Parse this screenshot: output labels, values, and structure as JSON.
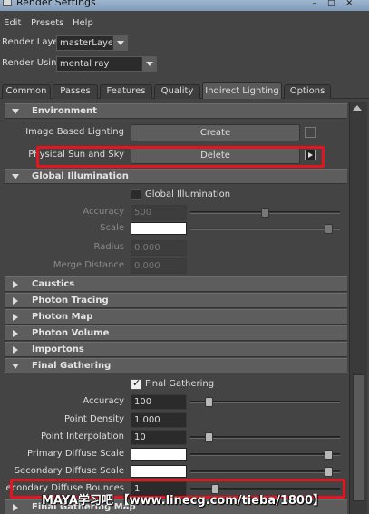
{
  "window": {
    "title": "Render Settings"
  },
  "menu": [
    "Edit",
    "Presets",
    "Help"
  ],
  "render_layer": {
    "label": "Render Layer",
    "value": "masterLayer"
  },
  "render_using": {
    "label": "Render Using",
    "value": "mental ray"
  },
  "tabs": [
    {
      "label": "Common",
      "active": false
    },
    {
      "label": "Passes",
      "active": false
    },
    {
      "label": "Features",
      "active": false
    },
    {
      "label": "Quality",
      "active": false
    },
    {
      "label": "Indirect Lighting",
      "active": true
    },
    {
      "label": "Options",
      "active": false
    }
  ],
  "environment": {
    "title": "Environment",
    "ibl_label": "Image Based Lighting",
    "ibl_button": "Create",
    "sun_label": "Physical Sun and Sky",
    "sun_button": "Delete"
  },
  "global_illumination": {
    "title": "Global Illumination",
    "checkbox_label": "Global Illumination",
    "enabled": false,
    "accuracy": {
      "label": "Accuracy",
      "value": "500",
      "slider": 0.5
    },
    "scale": {
      "label": "Scale",
      "color": "#ffffff",
      "slider": 0.95
    },
    "radius": {
      "label": "Radius",
      "value": "0.000"
    },
    "merge_distance": {
      "label": "Merge Distance",
      "value": "0.000"
    }
  },
  "collapsed_sections": [
    "Caustics",
    "Photon Tracing",
    "Photon Map",
    "Photon Volume",
    "Importons"
  ],
  "final_gathering": {
    "title": "Final Gathering",
    "checkbox_label": "Final Gathering",
    "enabled": true,
    "accuracy": {
      "label": "Accuracy",
      "value": "100",
      "slider": 0.1
    },
    "point_density": {
      "label": "Point Density",
      "value": "1.000"
    },
    "point_interpolation": {
      "label": "Point Interpolation",
      "value": "10",
      "slider": 0.1
    },
    "primary_diffuse_scale": {
      "label": "Primary Diffuse Scale",
      "color": "#ffffff",
      "slider": 0.95
    },
    "secondary_diffuse_scale": {
      "label": "Secondary Diffuse Scale",
      "color": "#ffffff",
      "slider": 0.95
    },
    "secondary_diffuse_bounces": {
      "label": "Secondary Diffuse Bounces",
      "value": "1",
      "slider": 0.15
    }
  },
  "final_gathering_map": {
    "title": "Final Gathering Map"
  },
  "watermark": "MAYA学习吧 【www.linecg.com/tieba/1800】",
  "colors": {
    "highlight": "#e6141e",
    "panel": "#444444",
    "section_header": "#5d5d5d"
  }
}
